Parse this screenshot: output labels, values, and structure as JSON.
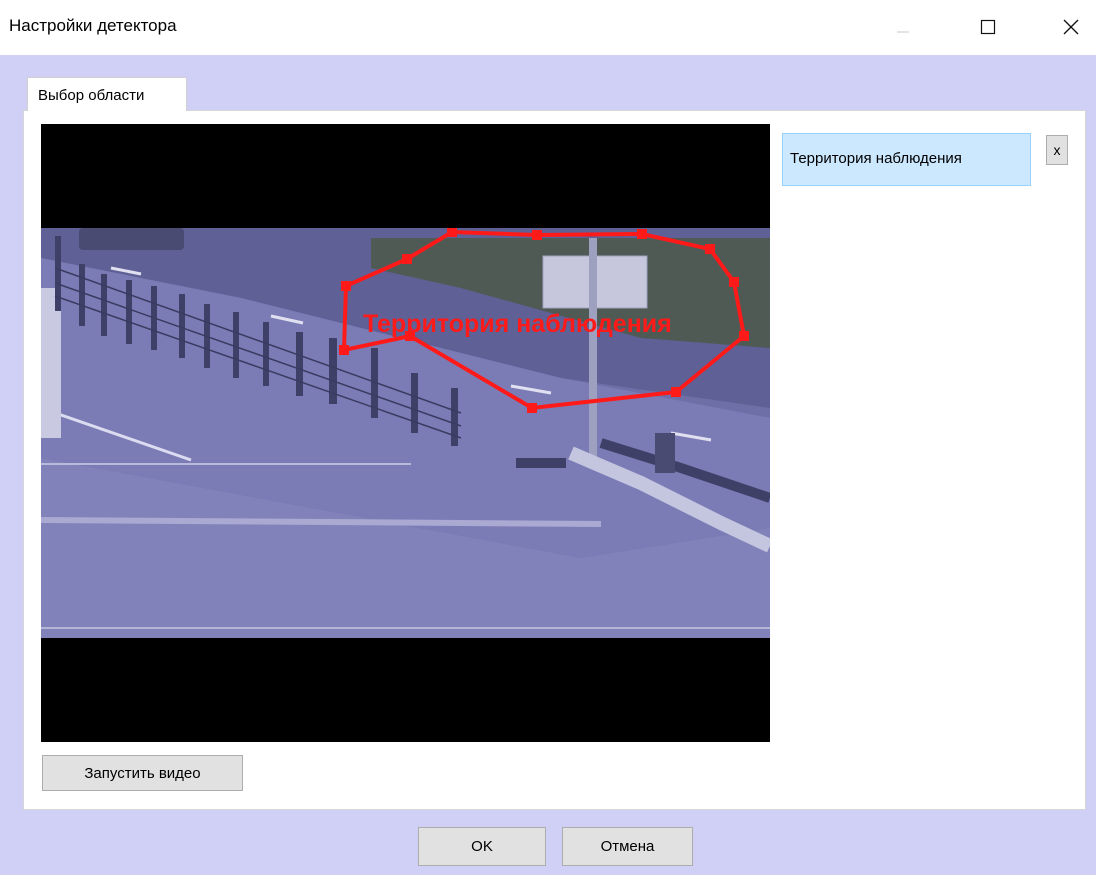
{
  "window": {
    "title": "Настройки детектора",
    "controls": [
      "minimize-icon",
      "maximize-icon",
      "close-icon"
    ]
  },
  "tabs": [
    {
      "label": "Выбор области",
      "active": true
    }
  ],
  "video": {
    "zone_label": "Территория наблюдения",
    "zone_color": "#ff1a1a"
  },
  "regions": {
    "items": [
      {
        "label": "Территория наблюдения",
        "selected": true
      }
    ],
    "delete_label": "x"
  },
  "buttons": {
    "start_video": "Запустить видео",
    "ok": "OK",
    "cancel": "Отмена"
  },
  "colors": {
    "client_background": "#d0d0f7",
    "selection": "#cce8ff",
    "video_tint": "#7a7bb3"
  }
}
